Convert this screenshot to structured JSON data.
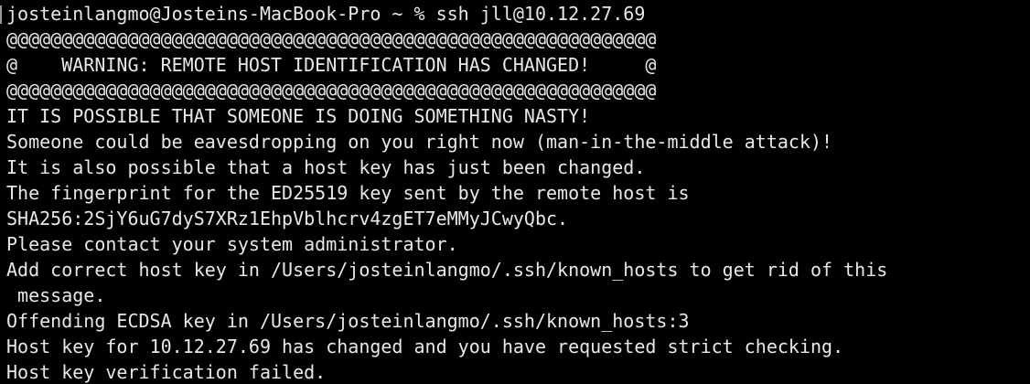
{
  "colors": {
    "background": "#000000",
    "text": "#e8e8e8"
  },
  "terminal": {
    "lines": [
      "josteinlangmo@Josteins-MacBook-Pro ~ % ssh jll@10.12.27.69",
      "@@@@@@@@@@@@@@@@@@@@@@@@@@@@@@@@@@@@@@@@@@@@@@@@@@@@@@@@@@@",
      "@    WARNING: REMOTE HOST IDENTIFICATION HAS CHANGED!     @",
      "@@@@@@@@@@@@@@@@@@@@@@@@@@@@@@@@@@@@@@@@@@@@@@@@@@@@@@@@@@@",
      "IT IS POSSIBLE THAT SOMEONE IS DOING SOMETHING NASTY!",
      "Someone could be eavesdropping on you right now (man-in-the-middle attack)!",
      "It is also possible that a host key has just been changed.",
      "The fingerprint for the ED25519 key sent by the remote host is",
      "SHA256:2SjY6uG7dyS7XRz1EhpVblhcrv4zgET7eMMyJCwyQbc.",
      "Please contact your system administrator.",
      "Add correct host key in /Users/josteinlangmo/.ssh/known_hosts to get rid of this",
      " message.",
      "Offending ECDSA key in /Users/josteinlangmo/.ssh/known_hosts:3",
      "Host key for 10.12.27.69 has changed and you have requested strict checking.",
      "Host key verification failed."
    ]
  }
}
